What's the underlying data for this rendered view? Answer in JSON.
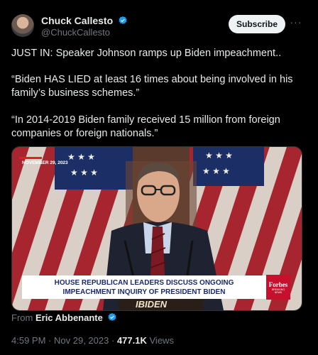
{
  "author": {
    "name": "Chuck Callesto",
    "handle": "@ChuckCallesto"
  },
  "subscribe_label": "Subscribe",
  "more_label": "···",
  "tweet": {
    "line1": "JUST IN: Speaker Johnson ramps up Biden impeachment..",
    "line2": "“Biden HAS LIED at least 16 times about being involved in his family’s business schemes.”",
    "line3": "“In 2014-2019 Biden family received 15 million from foreign companies or foreign nationals.”"
  },
  "video": {
    "date_tag": "NOVEMBER 29, 2023",
    "chyron_line1": "HOUSE REPUBLICAN LEADERS DISCUSS ONGOING",
    "chyron_line2": "IMPEACHMENT INQUIRY OF PRESIDENT BIDEN",
    "brand": "Forbes",
    "brand_sub": "BREAKING NEWS",
    "podium_text": "IBIDEN"
  },
  "source": {
    "prefix": "From",
    "name": "Eric Abbenante"
  },
  "meta": {
    "time": "4:59 PM",
    "date": "Nov 29, 2023",
    "views_count": "477.1K",
    "views_label": "Views"
  },
  "colors": {
    "verified": "#1d9bf0",
    "chyron_bg": "#ffffff",
    "chyron_text": "#1a2a6c",
    "brand_bg": "#c8102e"
  }
}
